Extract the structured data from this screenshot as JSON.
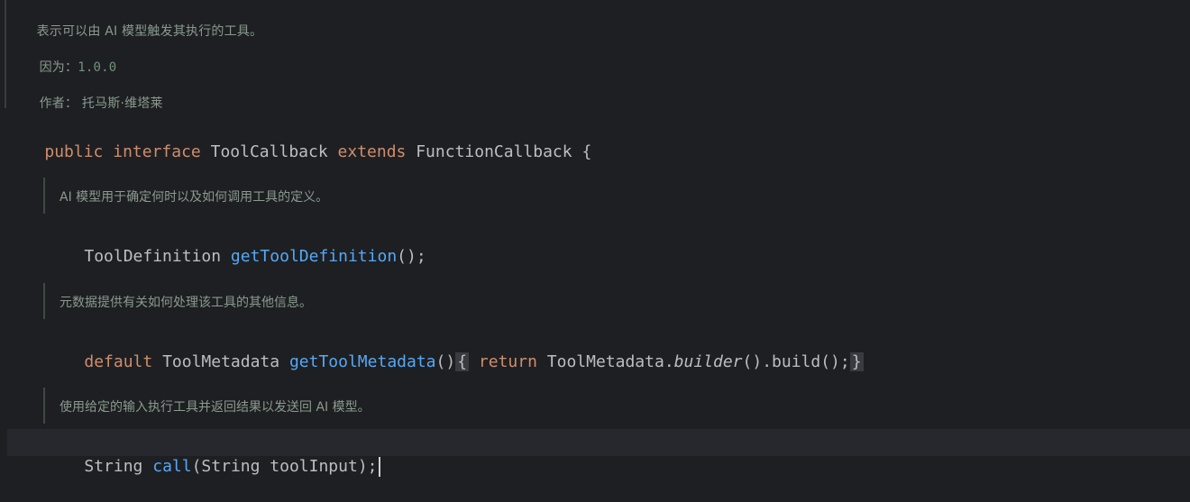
{
  "class_doc": {
    "description": "表示可以由 AI 模型触发其执行的工具。",
    "since_label": "因为：",
    "since_value": "1.0.0",
    "author_label": "作者：",
    "author_value": "托马斯·维塔莱"
  },
  "interface_decl": {
    "modifier": "public",
    "keyword": "interface",
    "name": "ToolCallback",
    "extends_kw": "extends",
    "parent": "FunctionCallback",
    "open_brace": "{"
  },
  "methods": [
    {
      "doc": "AI 模型用于确定何时以及如何调用工具的定义。",
      "return_type": "ToolDefinition",
      "name": "getToolDefinition",
      "params": "();"
    },
    {
      "doc": "元数据提供有关如何处理该工具的其他信息。",
      "modifier": "default",
      "return_type": "ToolMetadata",
      "name": "getToolMetadata",
      "params": "()",
      "body_open": "{",
      "body_return": "return",
      "body_class": "ToolMetadata",
      "body_dot": ".",
      "body_method": "builder",
      "body_rest": "().build();",
      "body_close": "}"
    },
    {
      "doc": "使用给定的输入执行工具并返回结果以发送回 AI 模型。",
      "return_type": "String",
      "name": "call",
      "params": "(String toolInput);"
    }
  ]
}
